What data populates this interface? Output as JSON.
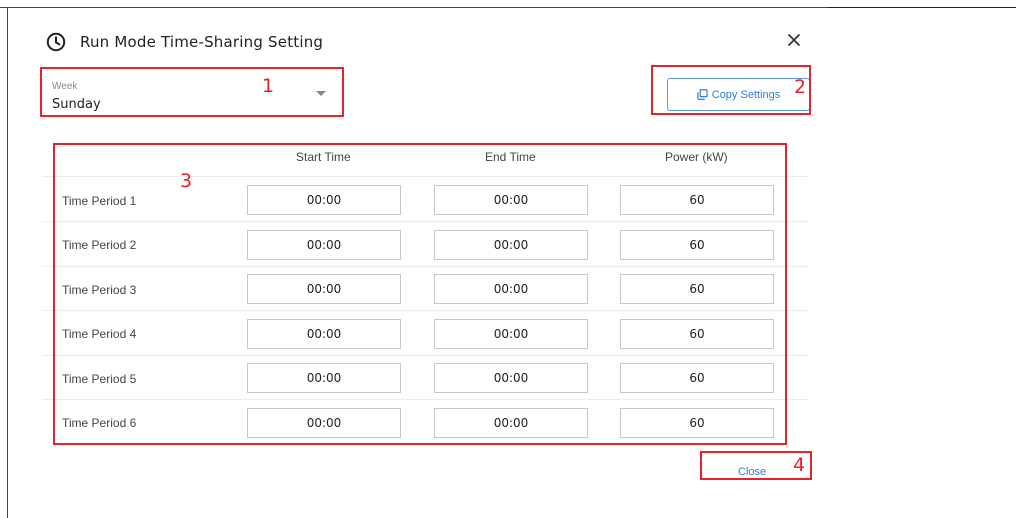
{
  "dialog": {
    "title": "Run Mode Time-Sharing Setting",
    "icons": {
      "title": "clock-icon",
      "close": "close-icon",
      "copy": "copy-icon",
      "dropdown": "chevron-down-icon"
    }
  },
  "week": {
    "label": "Week",
    "value": "Sunday"
  },
  "copy_button": {
    "label": "Copy Settings"
  },
  "table": {
    "headers": [
      "Start Time",
      "End Time",
      "Power (kW)"
    ],
    "rows": [
      {
        "label": "Time Period 1",
        "start": "00:00",
        "end": "00:00",
        "power": "60"
      },
      {
        "label": "Time Period 2",
        "start": "00:00",
        "end": "00:00",
        "power": "60"
      },
      {
        "label": "Time Period 3",
        "start": "00:00",
        "end": "00:00",
        "power": "60"
      },
      {
        "label": "Time Period 4",
        "start": "00:00",
        "end": "00:00",
        "power": "60"
      },
      {
        "label": "Time Period 5",
        "start": "00:00",
        "end": "00:00",
        "power": "60"
      },
      {
        "label": "Time Period 6",
        "start": "00:00",
        "end": "00:00",
        "power": "60"
      }
    ]
  },
  "close_button": {
    "label": "Close"
  },
  "annotations": {
    "marker_1": "1",
    "marker_2": "2",
    "marker_3": "3",
    "marker_4": "4",
    "color": "#e8202a"
  }
}
